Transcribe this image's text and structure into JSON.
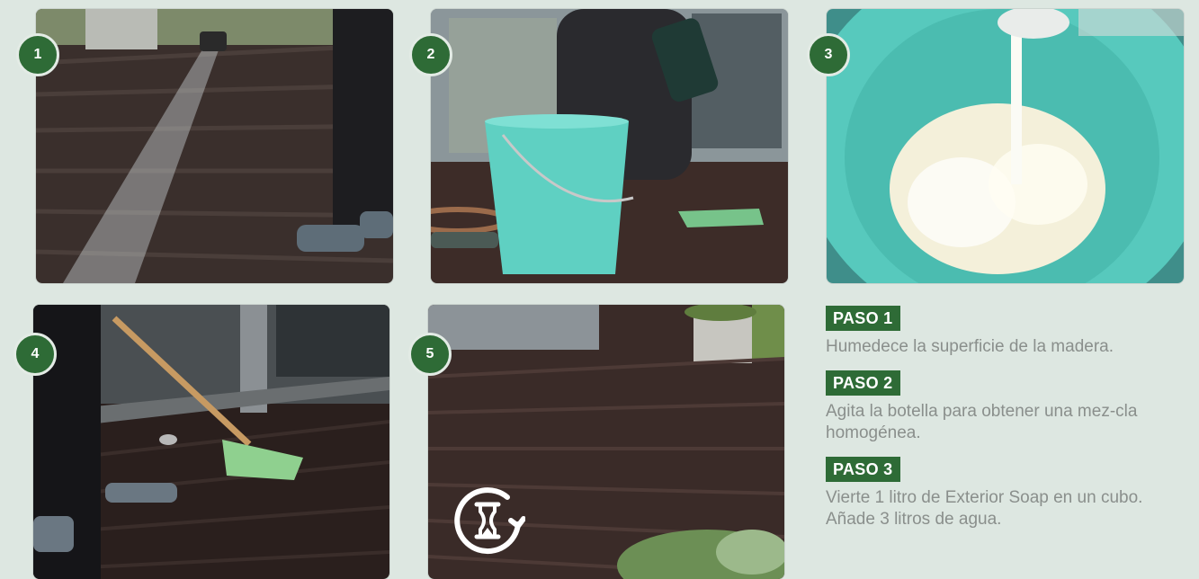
{
  "photos": [
    {
      "number": "1"
    },
    {
      "number": "2"
    },
    {
      "number": "3"
    },
    {
      "number": "4"
    },
    {
      "number": "5"
    }
  ],
  "steps": [
    {
      "title": "PASO 1",
      "text": "Humedece la superficie de la madera."
    },
    {
      "title": "PASO 2",
      "text": "Agita la botella para obtener una mez-cla homogénea."
    },
    {
      "title": "PASO 3",
      "text": "Vierte 1 litro de Exterior Soap en un cubo. Añade 3 litros de agua."
    }
  ],
  "icons": {
    "wait": "hourglass-rotate-icon"
  },
  "colors": {
    "accent": "#2e6b36",
    "background": "#dde7e1",
    "body_text": "#8a8f8c"
  }
}
